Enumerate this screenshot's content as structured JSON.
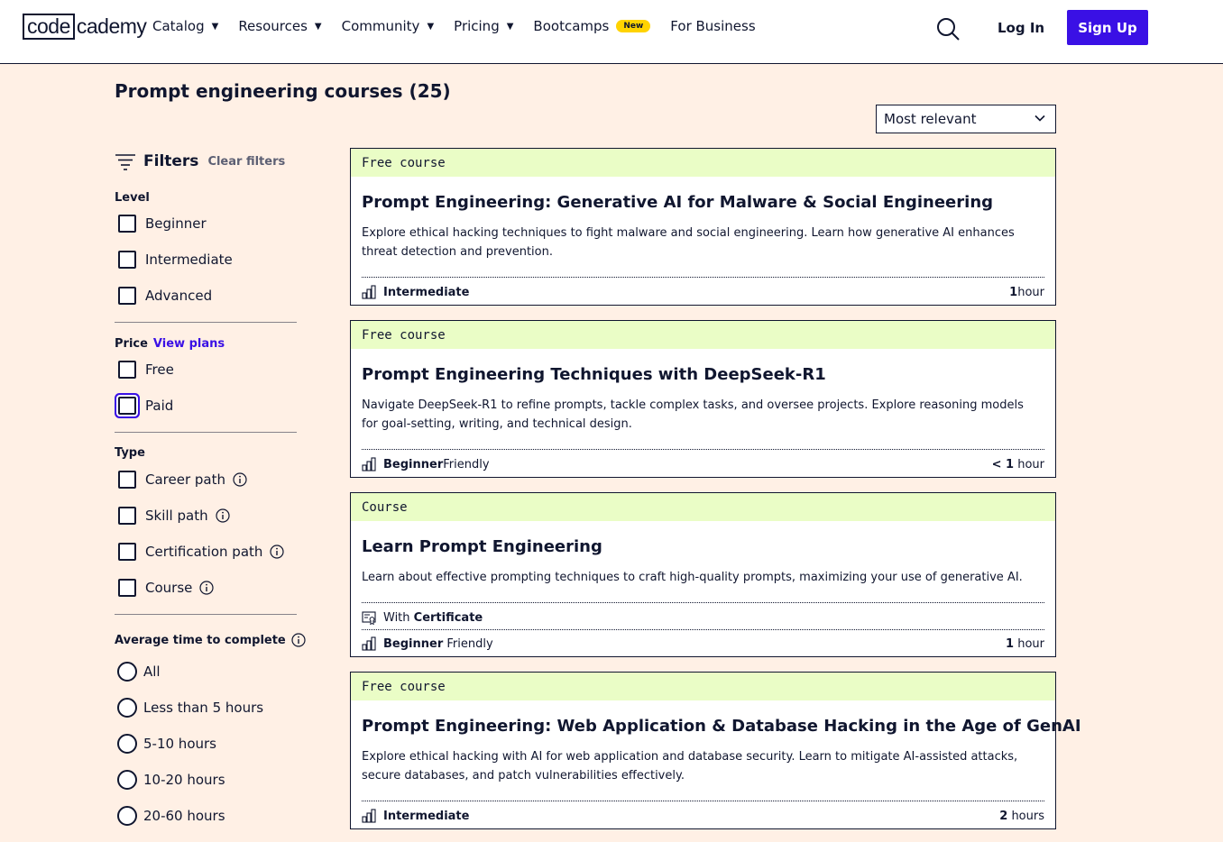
{
  "header": {
    "logo_box": "code",
    "logo_rest": "cademy",
    "nav": [
      {
        "label": "Catalog",
        "has_caret": true
      },
      {
        "label": "Resources",
        "has_caret": true
      },
      {
        "label": "Community",
        "has_caret": true
      },
      {
        "label": "Pricing",
        "has_caret": true
      },
      {
        "label": "Bootcamps",
        "has_caret": false,
        "badge": "New"
      },
      {
        "label": "For Business",
        "has_caret": false
      }
    ],
    "search_icon": "search-icon",
    "login_label": "Log In",
    "signup_label": "Sign Up"
  },
  "page": {
    "title": "Prompt engineering courses (25)",
    "sort_value": "Most relevant"
  },
  "filters": {
    "label": "Filters",
    "clear_label": "Clear filters",
    "level": {
      "label": "Level",
      "options": [
        "Beginner",
        "Intermediate",
        "Advanced"
      ]
    },
    "price": {
      "label": "Price",
      "view_plans": "View plans",
      "options": [
        "Free",
        "Paid"
      ]
    },
    "type": {
      "label": "Type",
      "options": [
        "Career path",
        "Skill path",
        "Certification path",
        "Course"
      ]
    },
    "time": {
      "label": "Average time to complete",
      "options": [
        "All",
        "Less than 5 hours",
        "5-10 hours",
        "10-20 hours",
        "20-60 hours"
      ]
    }
  },
  "courses": [
    {
      "tag": "Free course",
      "title": "Prompt Engineering: Generative AI for Malware & Social Engineering",
      "description": "Explore ethical hacking techniques to fight malware and social engineering. Learn how generative AI enhances threat detection and prevention.",
      "level_bold": "Intermediate",
      "level_rest": "",
      "duration_prefix": "",
      "duration_num": "1",
      "duration_unit": " hour"
    },
    {
      "tag": "Free course",
      "title": "Prompt Engineering Techniques with DeepSeek-R1",
      "description": "Navigate DeepSeek-R1 to refine prompts, tackle complex tasks, and oversee projects. Explore reasoning models for goal-setting, writing, and technical design.",
      "level_bold": "Beginner",
      "level_rest": " Friendly",
      "duration_prefix": "< ",
      "duration_num": "1",
      "duration_unit": " hour"
    },
    {
      "tag": "Course",
      "title": "Learn Prompt Engineering",
      "description": "Learn about effective prompting techniques to craft high-quality prompts, maximizing your use of generative AI.",
      "cert_prefix": "With ",
      "cert_bold": "Certificate",
      "level_bold": "Beginner",
      "level_rest": " Friendly",
      "duration_prefix": "",
      "duration_num": "1",
      "duration_unit": " hour"
    },
    {
      "tag": "Free course",
      "title": "Prompt Engineering: Web Application & Database Hacking in the Age of GenAI",
      "description": "Explore ethical hacking with AI for web application and database security. Learn to mitigate AI-assisted attacks, secure databases, and patch vulnerabilities effectively.",
      "level_bold": "Intermediate",
      "level_rest": "",
      "duration_prefix": "",
      "duration_num": "2",
      "duration_unit": " hours"
    }
  ],
  "colors": {
    "page_bg": "#fff0e5",
    "ink": "#10162f",
    "brand_primary": "#3a10e5",
    "tag_bg": "#eafdc6",
    "badge_yellow": "#ffd300"
  }
}
